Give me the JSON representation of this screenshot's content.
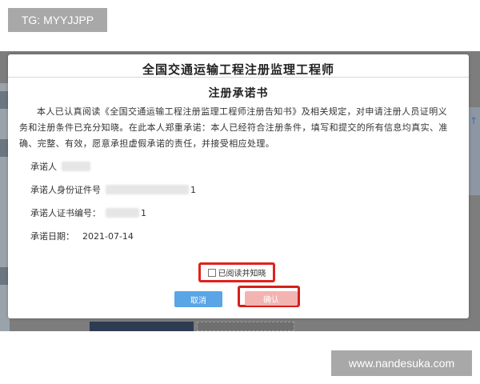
{
  "watermark_top": "TG: MYYJJPP",
  "watermark_bottom": "www.nandesuka.com",
  "dialog": {
    "title": "全国交通运输工程注册监理工程师",
    "subtitle": "注册承诺书",
    "paragraph": "本人已认真阅读《全国交通运输工程注册监理工程师注册告知书》及相关规定，对申请注册人员证明义务和注册条件已充分知晓。在此本人郑重承诺：本人已经符合注册条件，填写和提交的所有信息均真实、准确、完整、有效，愿意承担虚假承诺的责任，并接受相应处理。",
    "fields": {
      "promiser_label": "承诺人",
      "id_label": "承诺人身份证件号",
      "id_tail": "1",
      "cert_label": "承诺人证书编号：",
      "cert_tail": "1",
      "date_label": "承诺日期：",
      "date_value": "2021-07-14"
    },
    "agree_checkbox_label": "已阅读并知晓",
    "cancel_label": "取消",
    "confirm_label": "确认"
  },
  "colors": {
    "highlight_red": "#e0211d",
    "cancel_blue": "#5aa5e6",
    "confirm_pink": "#f3b3b1"
  }
}
